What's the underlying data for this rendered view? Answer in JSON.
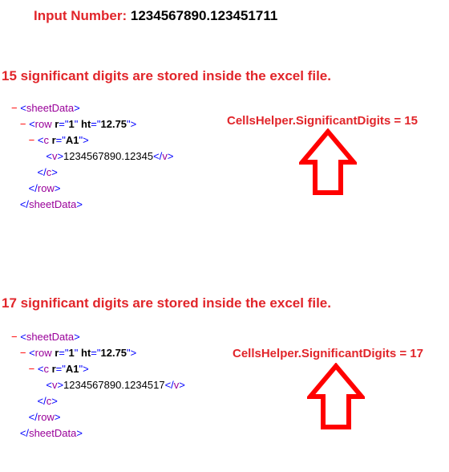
{
  "input": {
    "label": "Input Number: ",
    "value": "1234567890.123451711"
  },
  "sections": [
    {
      "heading": "15 significant digits are stored inside the excel file.",
      "annotation": "CellsHelper.SignificantDigits = 15",
      "value_text": "1234567890.12345"
    },
    {
      "heading": "17 significant digits are stored inside the excel file.",
      "annotation": "CellsHelper.SignificantDigits = 17",
      "value_text": "1234567890.1234517"
    }
  ],
  "xml": {
    "row_r": "1",
    "row_ht": "12.75",
    "c_r": "A1",
    "arrow_color": "#ff0000"
  }
}
